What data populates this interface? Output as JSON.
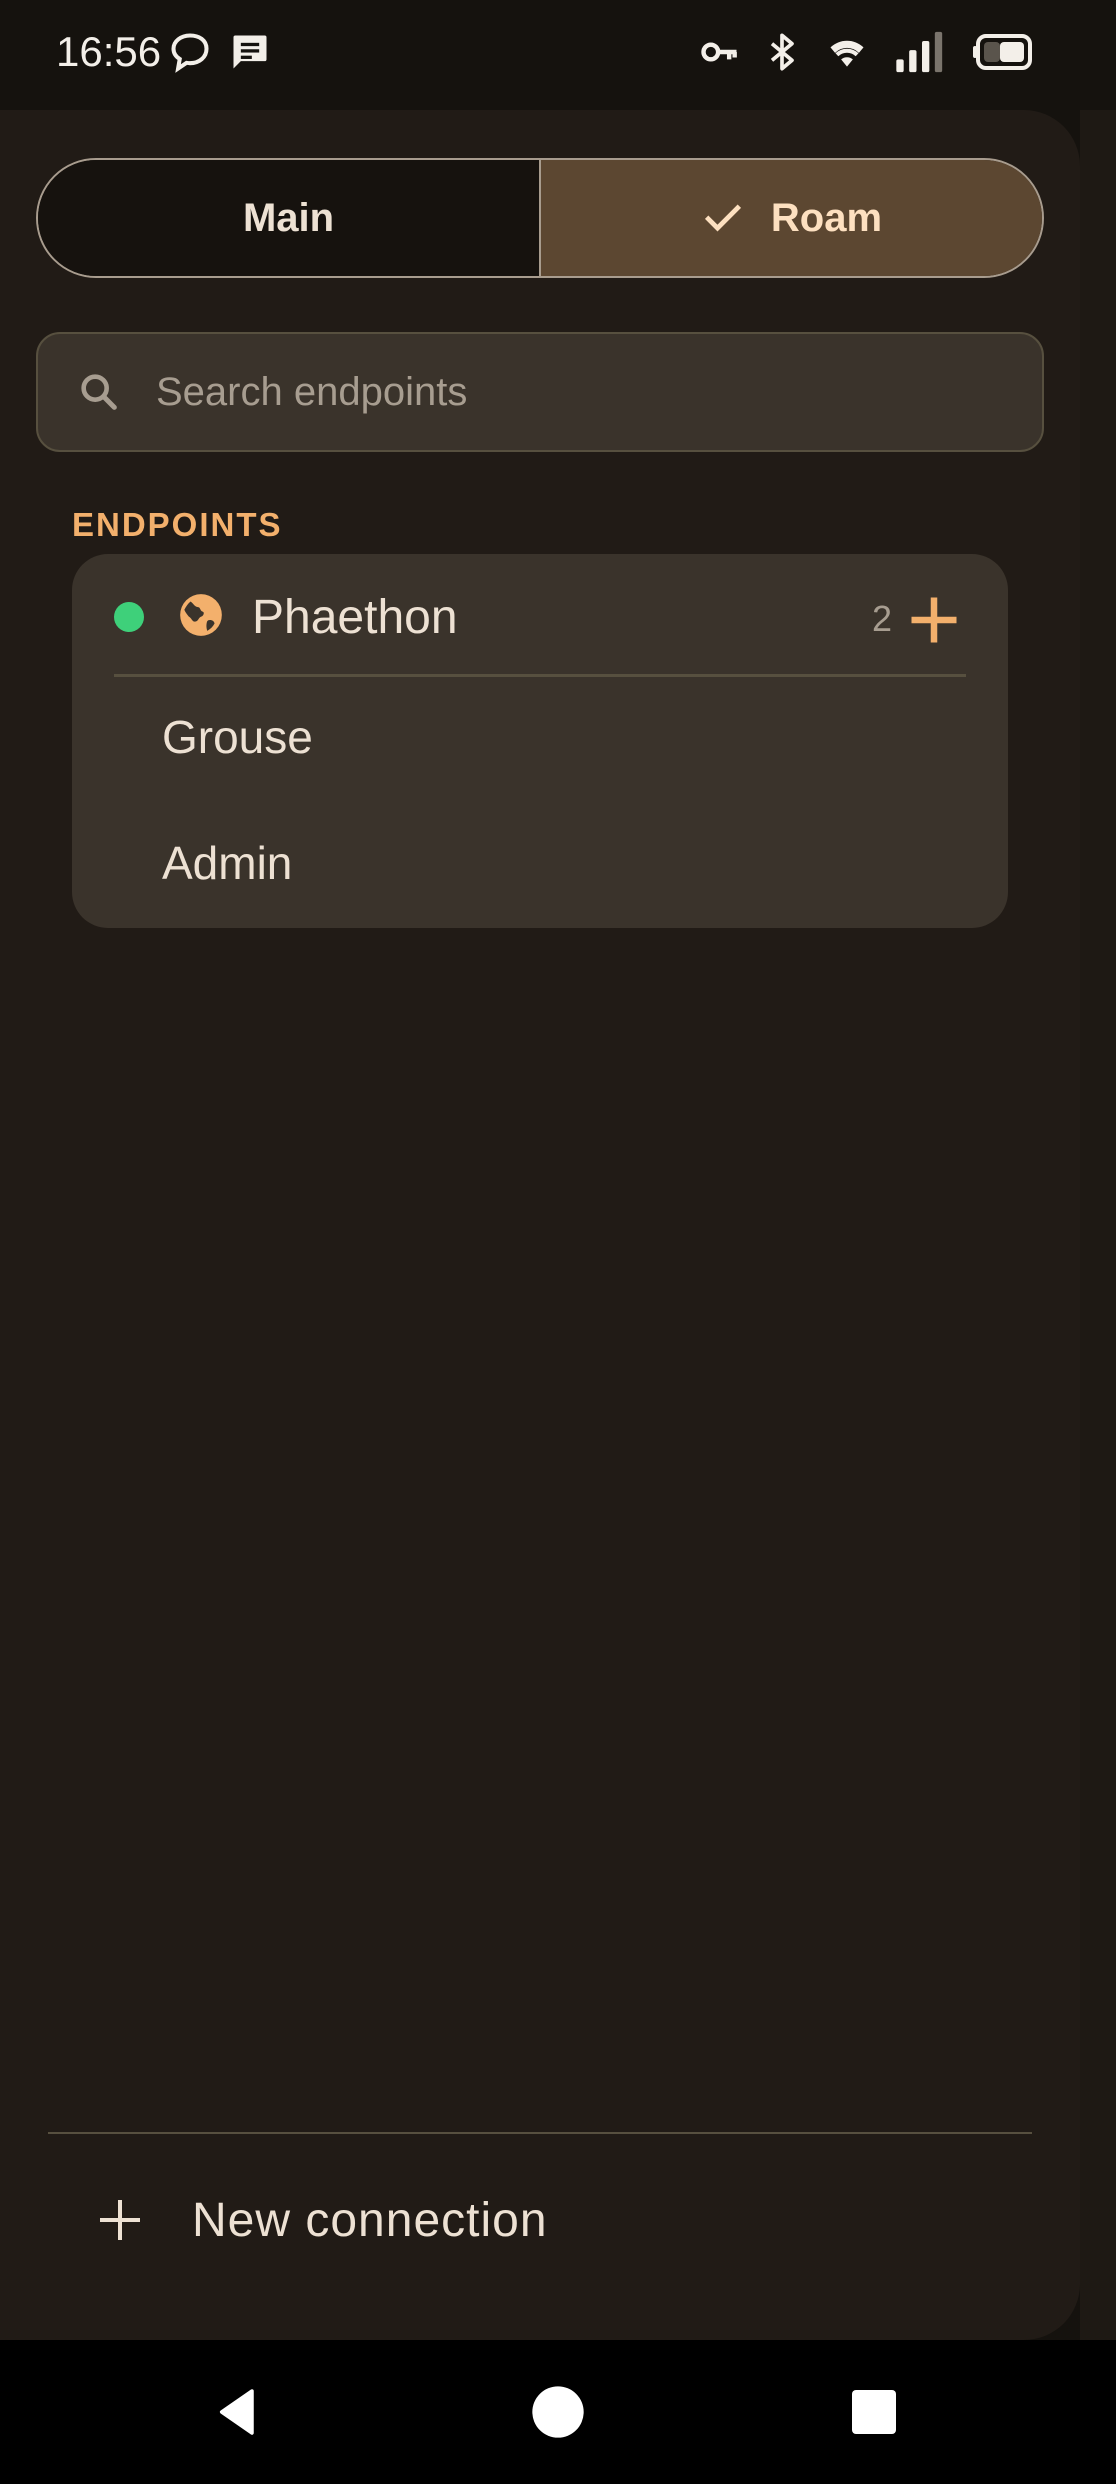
{
  "status_bar": {
    "time": "16:56",
    "left_icons": [
      "chat-bubble-icon",
      "message-icon"
    ],
    "right_icons": [
      "key-icon",
      "bluetooth-icon",
      "wifi-icon",
      "signal-icon",
      "battery-icon"
    ]
  },
  "mode_toggle": {
    "options": [
      {
        "label": "Main",
        "selected": false
      },
      {
        "label": "Roam",
        "selected": true
      }
    ]
  },
  "search": {
    "placeholder": "Search endpoints",
    "value": ""
  },
  "endpoints": {
    "section_label": "ENDPOINTS",
    "groups": [
      {
        "name": "Phaethon",
        "status_color": "#3ed07a",
        "icon": "globe-icon",
        "count": "2",
        "items": [
          "Grouse",
          "Admin"
        ]
      }
    ]
  },
  "footer": {
    "new_connection_label": "New connection"
  },
  "colors": {
    "accent": "#f3b06c",
    "selected_segment": "#5c4731",
    "drawer_bg": "#211b16",
    "card_bg": "#3a332b"
  },
  "nav_bar": {
    "buttons": [
      "back-icon",
      "home-icon",
      "recents-icon"
    ]
  }
}
